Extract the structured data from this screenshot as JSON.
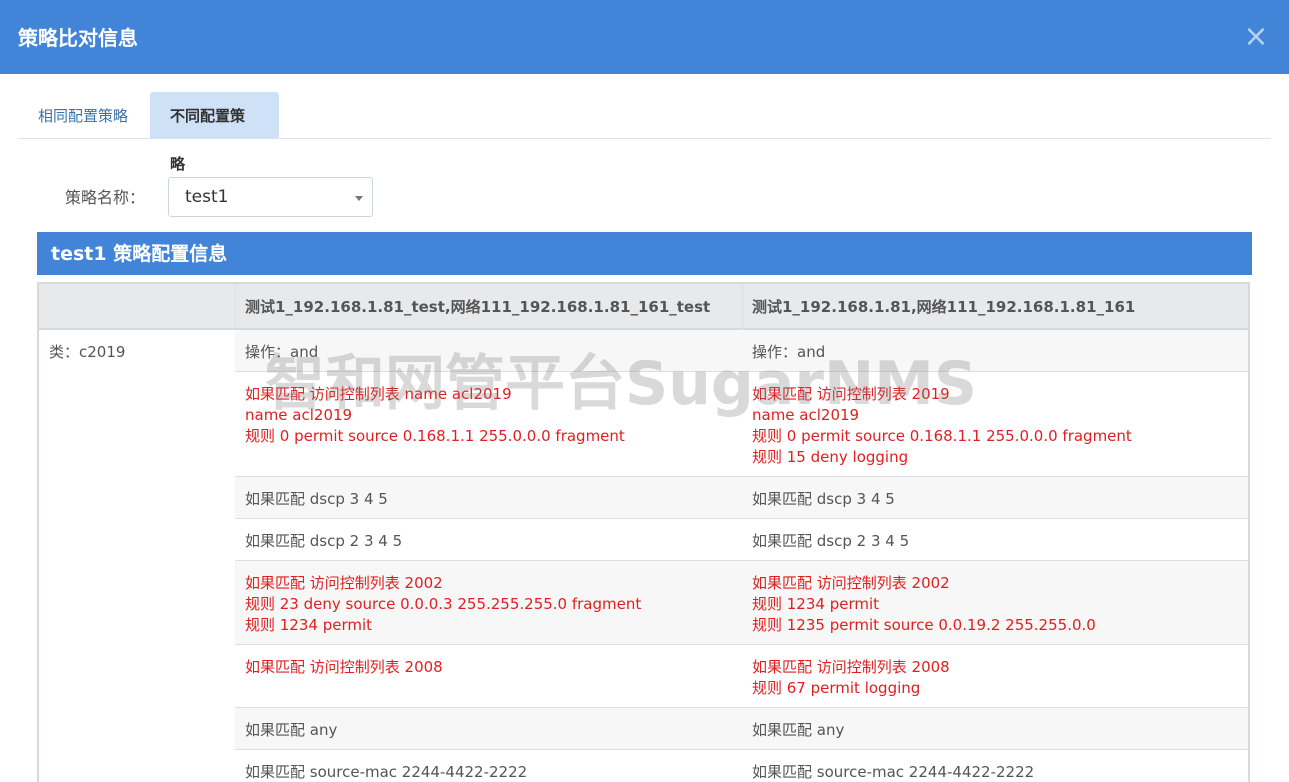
{
  "dialog": {
    "title": "策略比对信息",
    "close_icon": "×"
  },
  "tabs": [
    {
      "label": "相同配置策略",
      "active": false
    },
    {
      "label": "不同配置策略",
      "active": true
    }
  ],
  "form": {
    "label": "策略名称：",
    "select_value": "test1"
  },
  "panel": {
    "title": "test1 策略配置信息"
  },
  "table": {
    "headers": [
      "",
      "测试1_192.168.1.81_test,网络111_192.168.1.81_161_test",
      "测试1_192.168.1.81,网络111_192.168.1.81_161"
    ],
    "category": "类：c2019",
    "rows": [
      {
        "left": [
          "操作：and"
        ],
        "right": [
          "操作：and"
        ],
        "diff": false
      },
      {
        "left": [
          "如果匹配 访问控制列表 name acl2019",
          "name acl2019",
          "规则 0 permit source 0.168.1.1 255.0.0.0 fragment"
        ],
        "right": [
          "如果匹配 访问控制列表 2019",
          "name acl2019",
          "规则 0 permit source 0.168.1.1 255.0.0.0 fragment",
          "规则 15 deny logging"
        ],
        "diff": true
      },
      {
        "left": [
          "如果匹配 dscp 3 4 5"
        ],
        "right": [
          "如果匹配 dscp 3 4 5"
        ],
        "diff": false
      },
      {
        "left": [
          "如果匹配 dscp 2 3 4 5"
        ],
        "right": [
          "如果匹配 dscp 2 3 4 5"
        ],
        "diff": false
      },
      {
        "left": [
          "如果匹配 访问控制列表 2002",
          "规则 23 deny source 0.0.0.3 255.255.255.0 fragment",
          "规则 1234 permit"
        ],
        "right": [
          "如果匹配 访问控制列表 2002",
          "规则 1234 permit",
          "规则 1235 permit source 0.0.19.2 255.255.0.0"
        ],
        "diff": true
      },
      {
        "left": [
          "如果匹配 访问控制列表 2008"
        ],
        "right": [
          "如果匹配 访问控制列表 2008",
          "规则 67 permit logging"
        ],
        "diff": true
      },
      {
        "left": [
          "如果匹配 any"
        ],
        "right": [
          "如果匹配 any"
        ],
        "diff": false
      },
      {
        "left": [
          "如果匹配 source-mac 2244-4422-2222"
        ],
        "right": [
          "如果匹配 source-mac 2244-4422-2222"
        ],
        "diff": false
      }
    ]
  },
  "watermark": "智和网管平台SugarNMS",
  "colors": {
    "header_bg": "#4285d8",
    "tab_active_bg": "#cfe1f7",
    "diff_text": "#e02020"
  }
}
